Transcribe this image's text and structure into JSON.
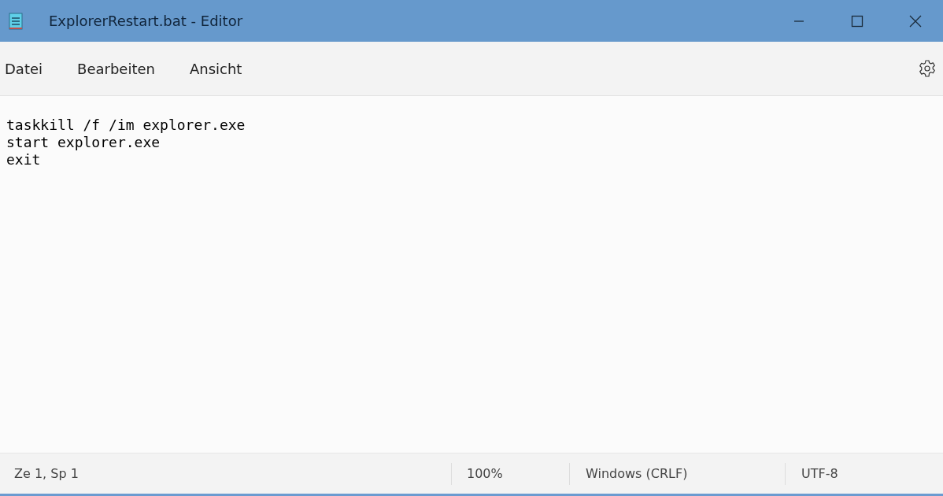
{
  "window": {
    "title": "ExplorerRestart.bat - Editor"
  },
  "menu": [
    "Datei",
    "Bearbeiten",
    "Ansicht"
  ],
  "editor": {
    "lines": [
      "taskkill /f /im explorer.exe",
      "start explorer.exe",
      "exit"
    ]
  },
  "status_bar": [
    "Ze 1, Sp 1",
    "100%",
    "Windows (CRLF)",
    "UTF-8"
  ]
}
